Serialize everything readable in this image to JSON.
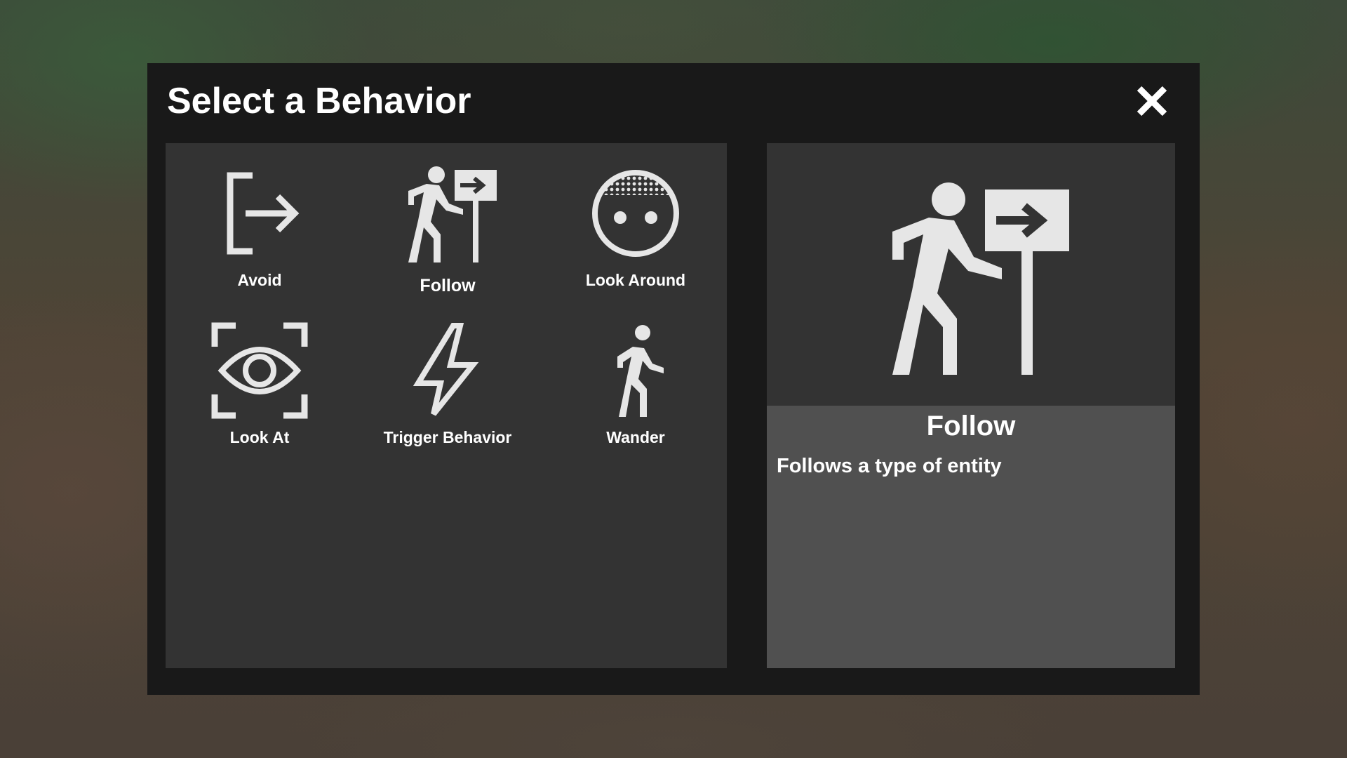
{
  "dialog": {
    "title": "Select a Behavior",
    "close_icon": "close-icon"
  },
  "behaviors": [
    {
      "label": "Avoid",
      "icon": "exit-arrow-icon"
    },
    {
      "label": "Follow",
      "icon": "person-sign-icon"
    },
    {
      "label": "Look Around",
      "icon": "face-icon"
    },
    {
      "label": "Look At",
      "icon": "eye-focus-icon"
    },
    {
      "label": "Trigger Behavior",
      "icon": "lightning-icon"
    },
    {
      "label": "Wander",
      "icon": "walking-person-icon"
    }
  ],
  "selected": {
    "name": "Follow",
    "description": "Follows a type of entity",
    "icon": "person-sign-icon"
  },
  "colors": {
    "dialog_bg": "#191919",
    "grid_bg": "#333333",
    "detail_bg": "#505050",
    "icon": "#e6e6e6",
    "text": "#ffffff"
  }
}
